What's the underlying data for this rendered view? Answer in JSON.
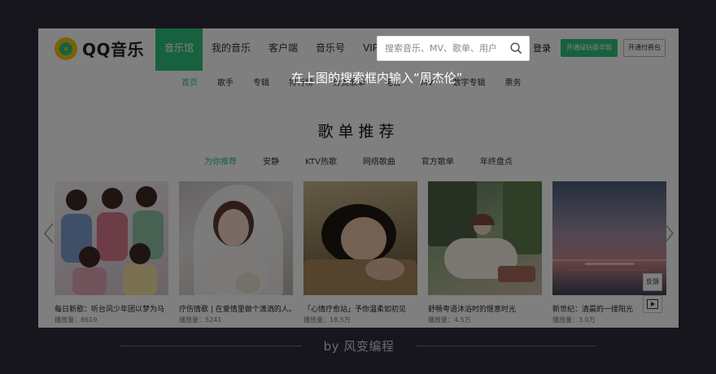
{
  "header": {
    "logo_text": "QQ音乐",
    "nav": [
      "音乐馆",
      "我的音乐",
      "客户端",
      "音乐号",
      "VIP"
    ],
    "active_nav": "音乐馆",
    "search_placeholder": "搜索音乐、MV、歌单、用户",
    "login": "登录",
    "btn_green": "开通绿钻豪华版",
    "btn_outline": "开通付费包"
  },
  "subnav": [
    "首页",
    "歌手",
    "专辑",
    "排行榜",
    "分类歌单",
    "电台",
    "MV",
    "数字专辑",
    "票务"
  ],
  "section": {
    "title": "歌单推荐",
    "tabs": [
      "为你推荐",
      "安静",
      "KTV热歌",
      "网络歌曲",
      "官方歌单",
      "年终盘点"
    ]
  },
  "cards": [
    {
      "title": "每日新歌：听台风少年团以梦为马",
      "count": "播放量：8619"
    },
    {
      "title": "疗伤情歌 | 在爱情里做个潇洒的人。",
      "count": "播放量：5241"
    },
    {
      "title": "「心情疗愈站」予你温柔如初见",
      "count": "播放量：18.5万"
    },
    {
      "title": "舒畅粤语沐浴时的惬意时光",
      "count": "播放量：4.5万"
    },
    {
      "title": "新世纪：清晨的一缕阳光",
      "count": "播放量：3.0万"
    }
  ],
  "side": {
    "feedback": "反馈"
  },
  "instruction": "在上图的搜索框内输入“周杰伦”",
  "footer": "by 风变编程",
  "colors": {
    "accent": "#31c27c",
    "background": "#17161d",
    "overlay": "rgba(0,0,0,0.5)"
  }
}
